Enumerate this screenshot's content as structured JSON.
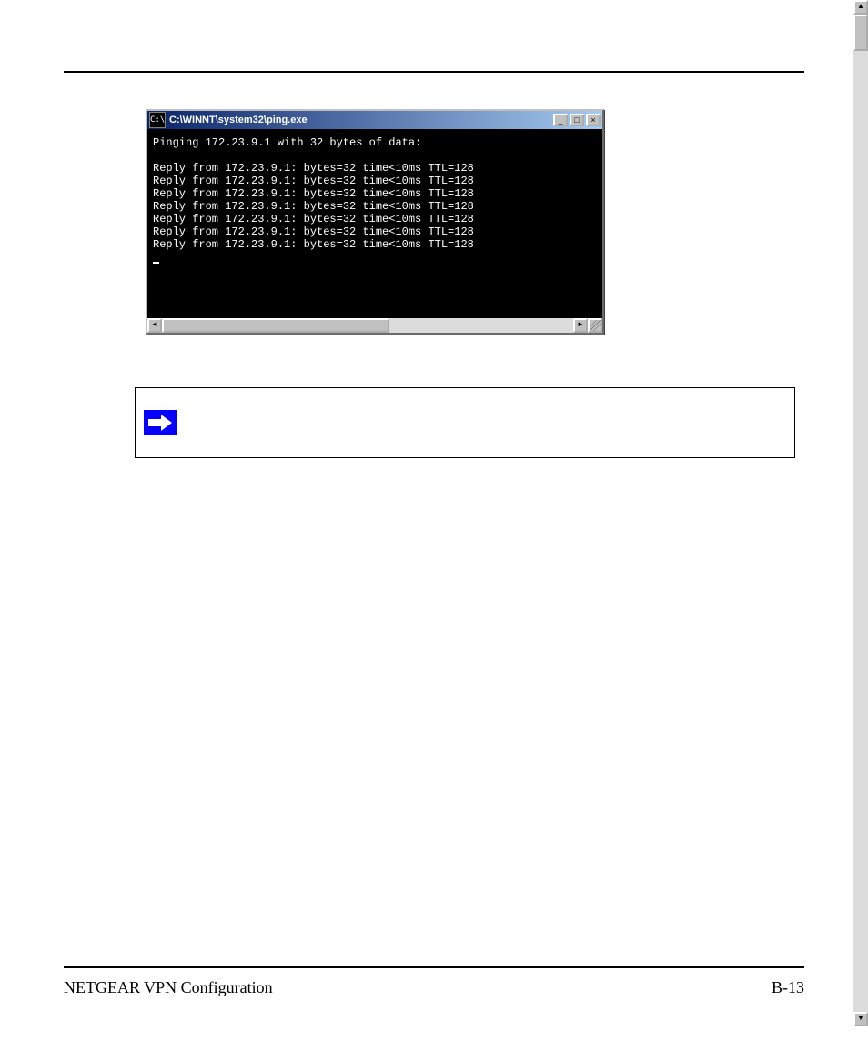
{
  "cmd_window": {
    "title": "C:\\WINNT\\system32\\ping.exe",
    "icon_glyph": "C:\\",
    "buttons": {
      "min": "_",
      "max": "□",
      "close": "×"
    },
    "lines": [
      "Pinging 172.23.9.1 with 32 bytes of data:",
      "",
      "Reply from 172.23.9.1: bytes=32 time<10ms TTL=128",
      "Reply from 172.23.9.1: bytes=32 time<10ms TTL=128",
      "Reply from 172.23.9.1: bytes=32 time<10ms TTL=128",
      "Reply from 172.23.9.1: bytes=32 time<10ms TTL=128",
      "Reply from 172.23.9.1: bytes=32 time<10ms TTL=128",
      "Reply from 172.23.9.1: bytes=32 time<10ms TTL=128",
      "Reply from 172.23.9.1: bytes=32 time<10ms TTL=128"
    ],
    "scroll_arrows": {
      "up": "▲",
      "down": "▼",
      "left": "◄",
      "right": "►"
    }
  },
  "footer": {
    "left": "NETGEAR VPN Configuration",
    "right": "B-13"
  }
}
